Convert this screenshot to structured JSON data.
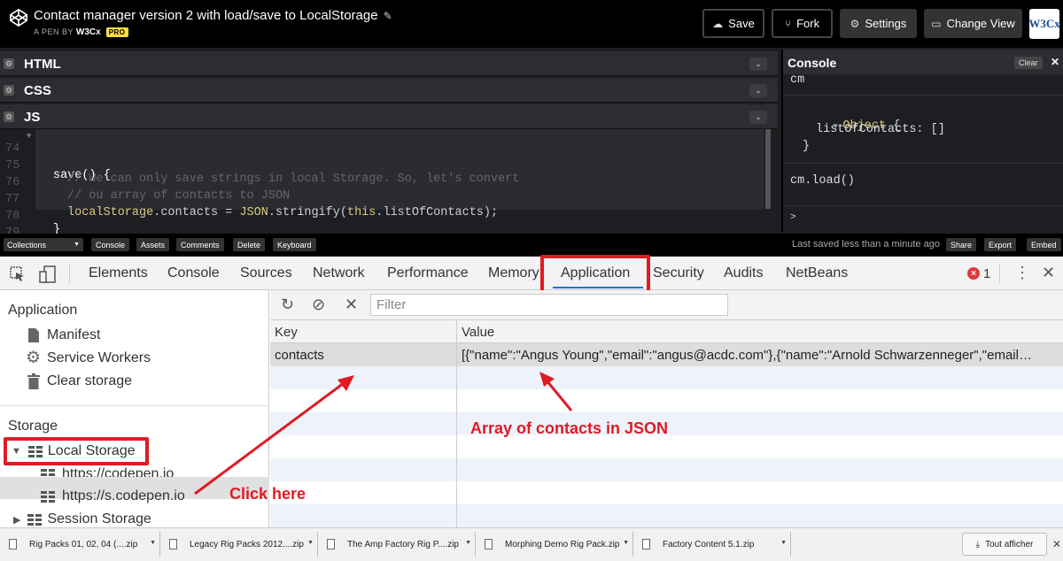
{
  "header": {
    "title": "Contact manager version 2 with load/save to LocalStorage",
    "pen_by": "A PEN BY",
    "author": "W3Cx",
    "pro": "PRO",
    "buttons": {
      "save": "Save",
      "fork": "Fork",
      "settings": "Settings",
      "change_view": "Change View"
    },
    "avatar": "W3Cx"
  },
  "editors": {
    "panels": [
      "HTML",
      "CSS",
      "JS"
    ],
    "code": [
      {
        "ln": "74",
        "text": "save() {"
      },
      {
        "ln": "75",
        "text": "// We can only save strings in local Storage. So, let's convert"
      },
      {
        "ln": "76",
        "text": "// ou array of contacts to JSON"
      },
      {
        "ln": "77",
        "a": "localStorage",
        "b": ".contacts = ",
        "c": "JSON",
        "d": ".stringify(",
        "e": "this",
        "f": ".listOfContacts);"
      },
      {
        "ln": "78",
        "text": "}"
      },
      {
        "ln": "79",
        "text": "}"
      }
    ]
  },
  "console": {
    "title": "Console",
    "clear": "Clear",
    "lines": {
      "l1": "cm",
      "l2a": "Object",
      "l2b": " {",
      "l3": "listOfContacts: []",
      "l4": "}",
      "l5": "cm.load()",
      "prompt": ">"
    }
  },
  "bottom_bar": {
    "collections": "Collections",
    "buttons": [
      "Console",
      "Assets",
      "Comments",
      "Delete",
      "Keyboard"
    ],
    "saved": "Last saved less than a minute ago",
    "right_buttons": [
      "Share",
      "Export",
      "Embed"
    ]
  },
  "devtools": {
    "tabs": [
      "Elements",
      "Console",
      "Sources",
      "Network",
      "Performance",
      "Memory",
      "Application",
      "Security",
      "Audits",
      "NetBeans"
    ],
    "active_tab": "Application",
    "error_count": "1",
    "sidebar": {
      "application_header": "Application",
      "app_items": [
        "Manifest",
        "Service Workers",
        "Clear storage"
      ],
      "storage_header": "Storage",
      "local_storage": "Local Storage",
      "local_children": [
        "https://codepen.io",
        "https://s.codepen.io"
      ],
      "session_storage": "Session Storage"
    },
    "filter_placeholder": "Filter",
    "table": {
      "headers": [
        "Key",
        "Value"
      ],
      "rows": [
        {
          "key": "contacts",
          "value": "[{\"name\":\"Angus Young\",\"email\":\"angus@acdc.com\"},{\"name\":\"Arnold Schwarzenneger\",\"email…"
        }
      ]
    }
  },
  "annotations": {
    "json": "Array of contacts in JSON",
    "click": "Click here",
    "color": "#e01b24"
  },
  "downloads": {
    "items": [
      "Rig Packs 01, 02, 04 (....zip",
      "Legacy Rig Packs 2012....zip",
      "The Amp Factory Rig P....zip",
      "Morphing Demo Rig Pack.zip",
      "Factory Content 5.1.zip"
    ],
    "show_all": "Tout afficher"
  }
}
